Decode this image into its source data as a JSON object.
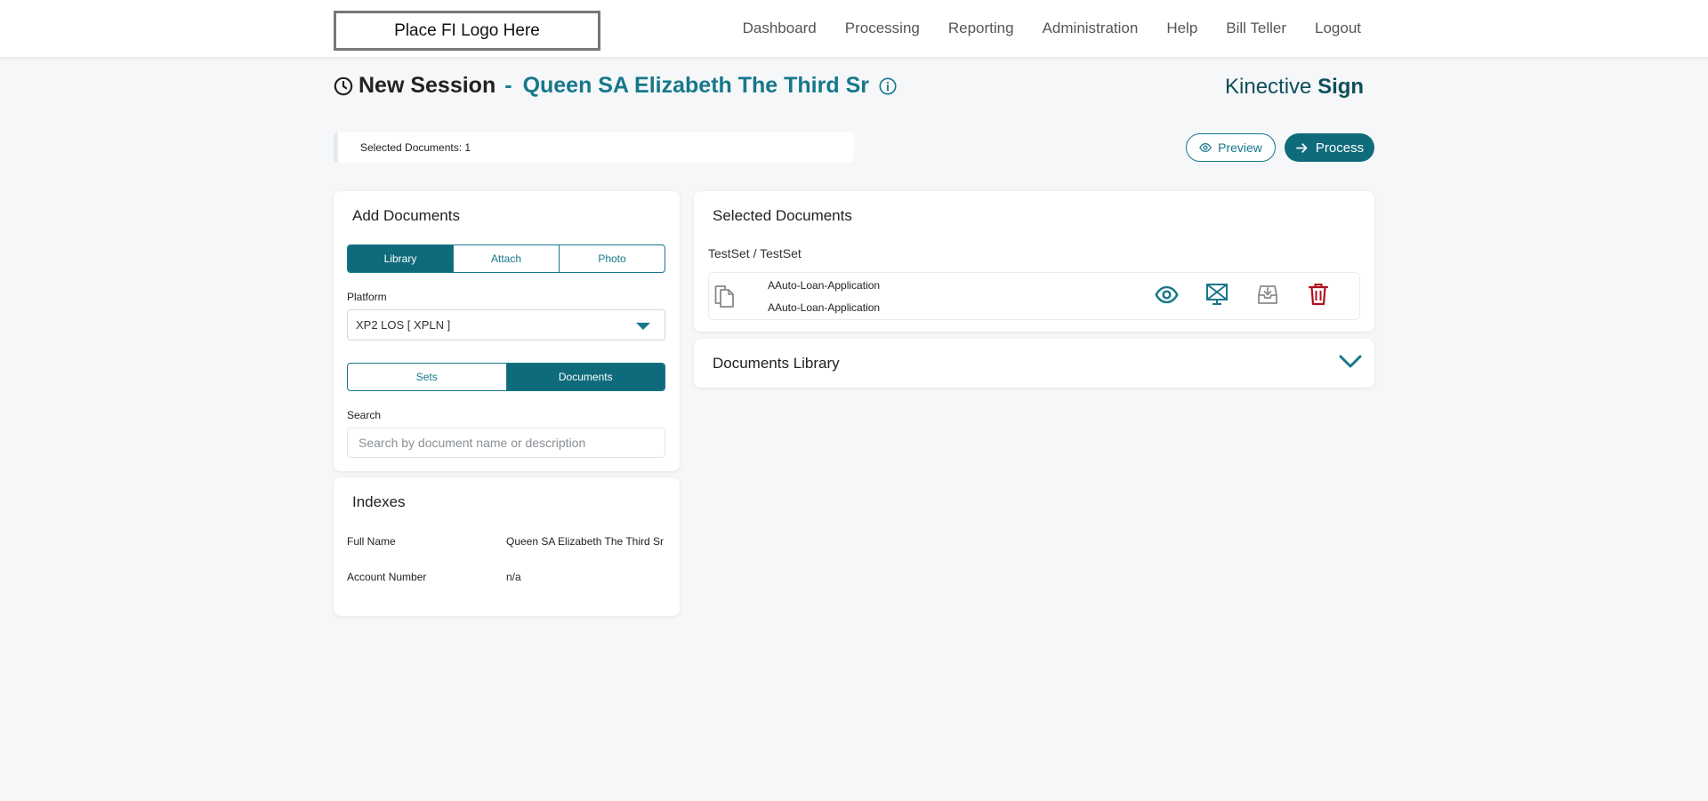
{
  "header": {
    "logo_text": "Place FI Logo Here",
    "nav": [
      "Dashboard",
      "Processing",
      "Reporting",
      "Administration",
      "Help",
      "Bill Teller",
      "Logout"
    ]
  },
  "session": {
    "title": "New Session",
    "dash": "-",
    "customer_name": "Queen SA Elizabeth The Third Sr"
  },
  "brand": {
    "part1": "Kinective",
    "part2": "Sign"
  },
  "selected_bar": {
    "text": "Selected Documents: 1"
  },
  "actions": {
    "preview_label": "Preview",
    "process_label": "Process"
  },
  "add_documents": {
    "title": "Add Documents",
    "source_tabs": [
      "Library",
      "Attach",
      "Photo"
    ],
    "active_source": "Library",
    "platform_label": "Platform",
    "platform_value": "XP2 LOS [ XPLN ]",
    "type_tabs": [
      "Sets",
      "Documents"
    ],
    "active_type": "Documents",
    "search_label": "Search",
    "search_placeholder": "Search by document name or description"
  },
  "indexes": {
    "title": "Indexes",
    "rows": [
      {
        "label": "Full Name",
        "value": "Queen SA Elizabeth The Third Sr"
      },
      {
        "label": "Account Number",
        "value": "n/a"
      }
    ]
  },
  "selected_documents": {
    "title": "Selected Documents",
    "set_path": "TestSet / TestSet",
    "documents": [
      {
        "name": "AAuto-Loan-Application",
        "description": "AAuto-Loan-Application"
      }
    ]
  },
  "documents_library": {
    "title": "Documents Library"
  },
  "colors": {
    "accent": "#0f6b7b",
    "accent_text": "#16788a",
    "danger": "#b30f1f"
  },
  "icons": [
    "clock-icon",
    "info-icon",
    "eye-icon",
    "arrow-right-icon",
    "documents-copy-icon",
    "no-sign-icon",
    "inbox-download-icon",
    "trash-icon",
    "chevron-down-icon"
  ]
}
